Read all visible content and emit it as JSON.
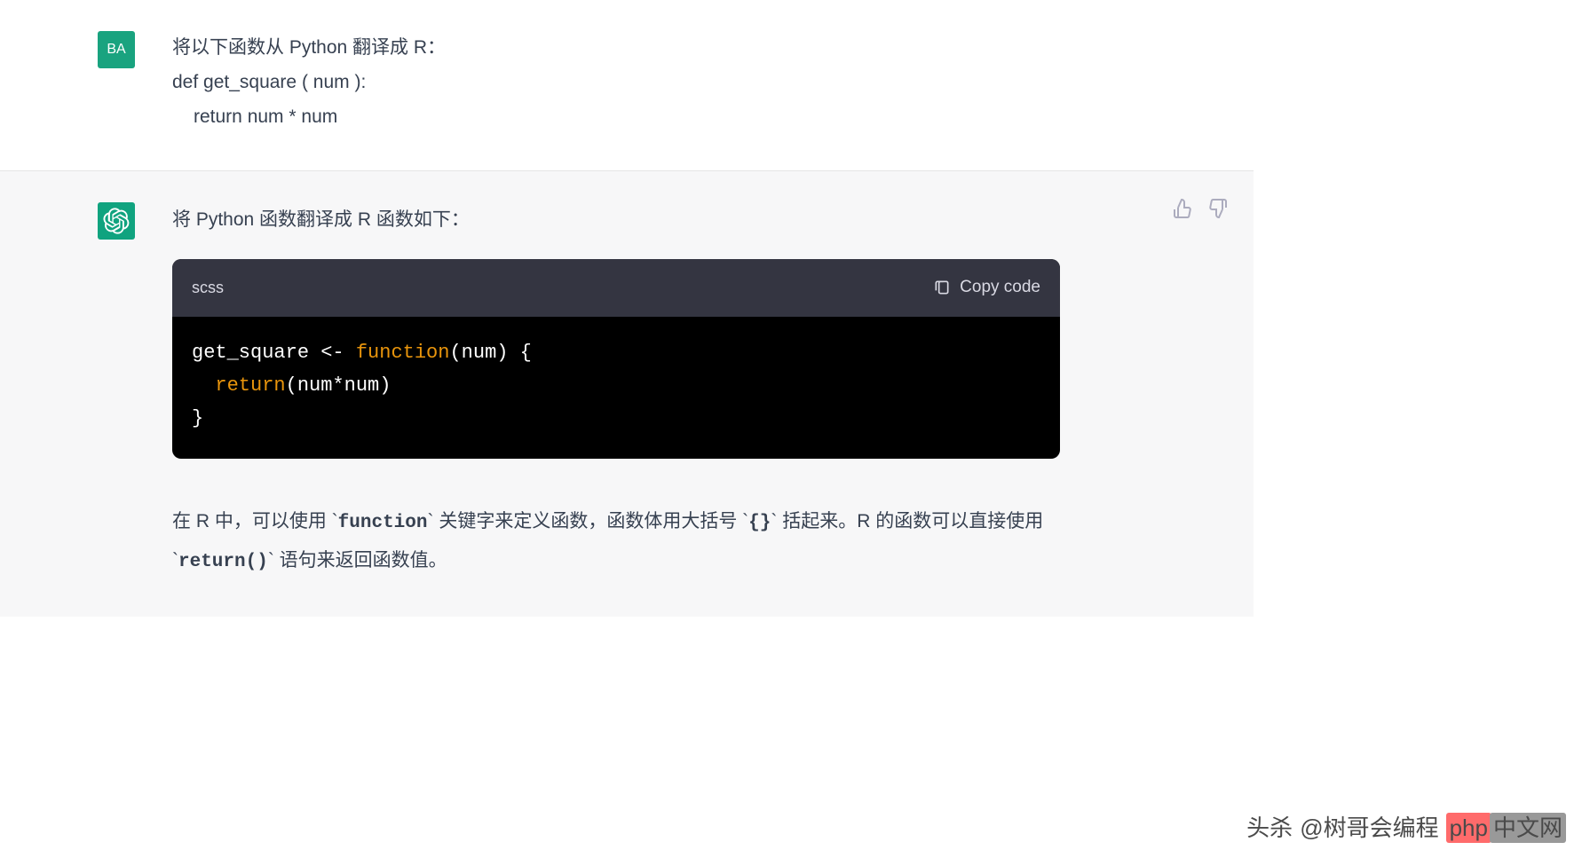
{
  "user": {
    "avatar": "BA",
    "prompt_line1": "将以下函数从 Python 翻译成 R：",
    "prompt_line2": "def  get_square ( num ):",
    "prompt_line3": "return num * num"
  },
  "assistant": {
    "intro": "将 Python 函数翻译成 R 函数如下：",
    "code": {
      "language": "scss",
      "copy_label": "Copy code",
      "tokens": {
        "t1": "get_square <- ",
        "t2": "function",
        "t3": "(num) {",
        "t4": "  ",
        "t5": "return",
        "t6": "(num*num)",
        "t7": "}"
      }
    },
    "explanation": {
      "part1": "在 R 中，可以使用 `",
      "code1": "function",
      "part2": "` 关键字来定义函数，函数体用大括号 `",
      "code2": "{}",
      "part3": "` 括起来。R 的函数可以直接使用 `",
      "code3": "return()",
      "part4": "` 语句来返回函数值。"
    }
  },
  "watermark": {
    "prefix": "头杀",
    "handle": "@树哥会编程",
    "badge1": "php",
    "badge2": "中文网"
  }
}
